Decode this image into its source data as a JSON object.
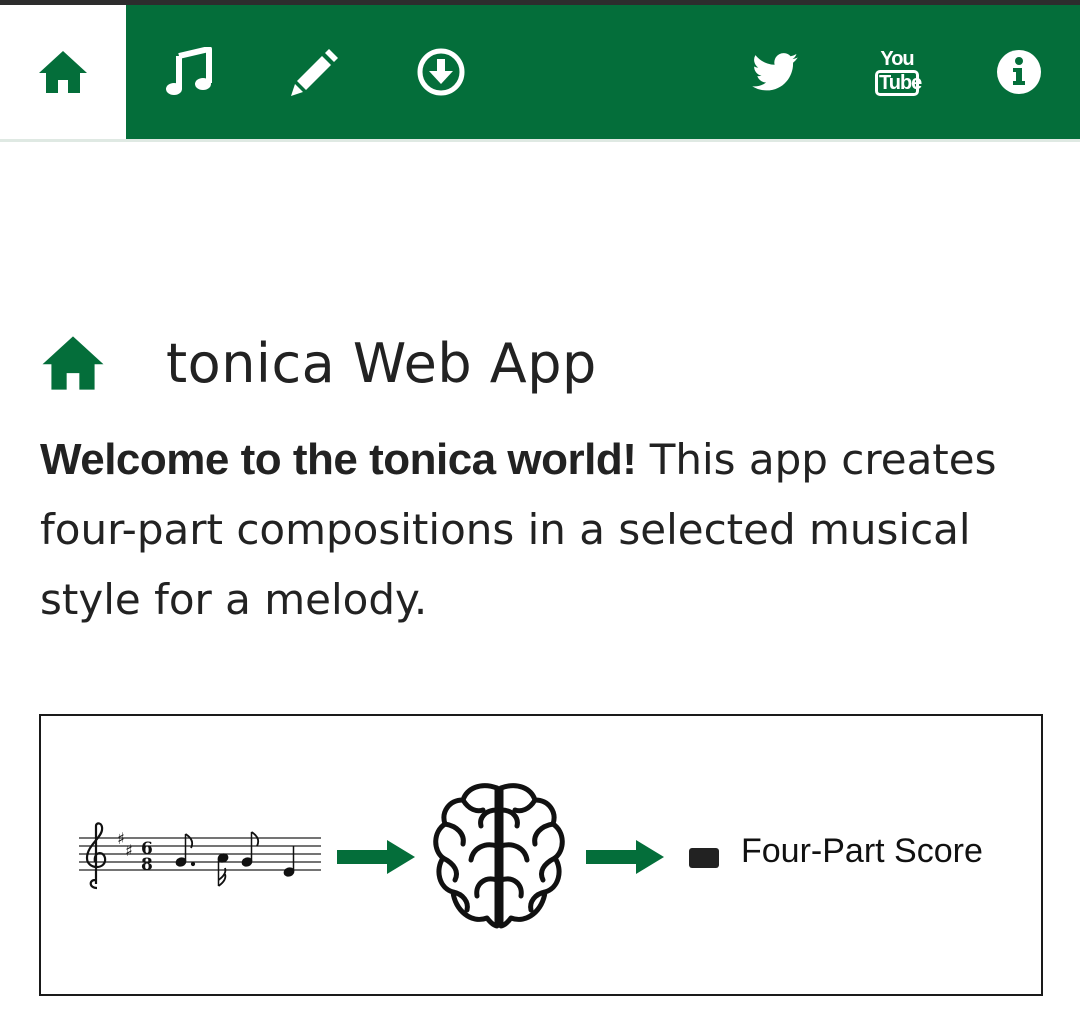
{
  "nav": {
    "items": [
      {
        "name": "home-icon",
        "active": true
      },
      {
        "name": "music-note-icon",
        "active": false
      },
      {
        "name": "pencil-icon",
        "active": false
      },
      {
        "name": "download-icon",
        "active": false
      },
      {
        "name": "twitter-icon",
        "active": false
      },
      {
        "name": "youtube-icon",
        "active": false,
        "text_top": "You",
        "text_bottom": "Tube"
      },
      {
        "name": "info-icon",
        "active": false
      }
    ]
  },
  "page": {
    "title": "tonica Web App",
    "intro_bold": "Welcome to the tonica world!",
    "intro_text": " This app creates four-part compositions in a selected musical style for a melody."
  },
  "figure": {
    "time_signature_top": "6",
    "time_signature_bottom": "8",
    "output_label": "Four-Part Score"
  },
  "colors": {
    "brand_green": "#046e3a",
    "text": "#222222",
    "border": "#1a1a1a"
  }
}
